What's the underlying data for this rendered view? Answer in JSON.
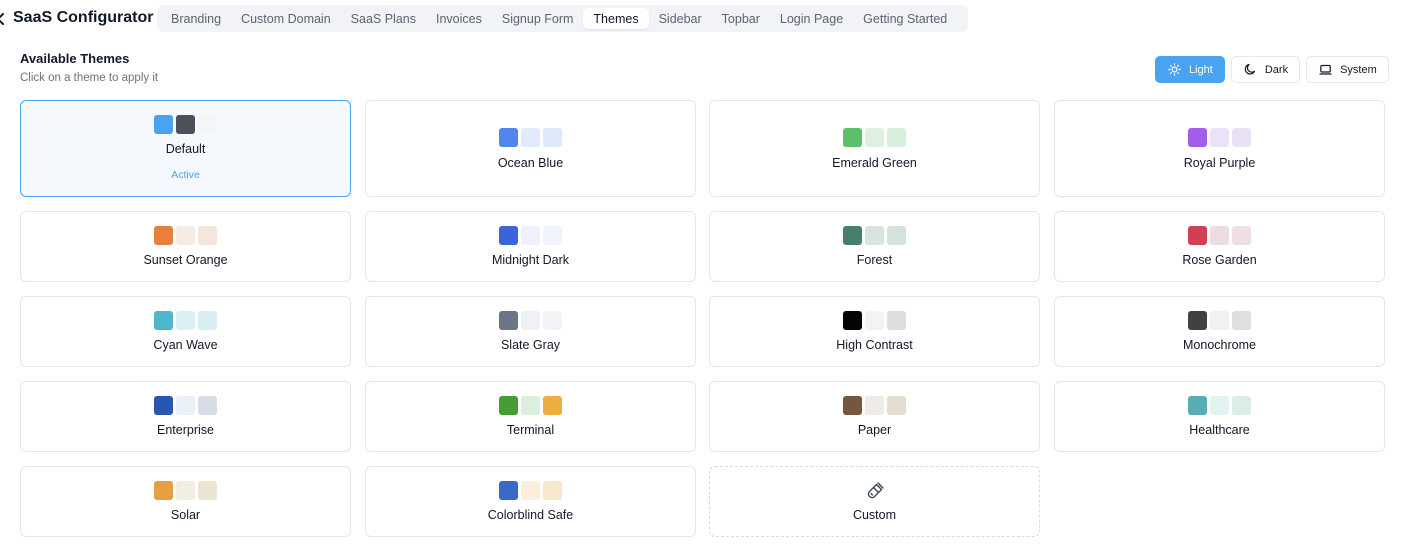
{
  "app": {
    "title": "SaaS Configurator"
  },
  "tabs": [
    {
      "label": "Branding",
      "active": false
    },
    {
      "label": "Custom Domain",
      "active": false
    },
    {
      "label": "SaaS Plans",
      "active": false
    },
    {
      "label": "Invoices",
      "active": false
    },
    {
      "label": "Signup Form",
      "active": false
    },
    {
      "label": "Themes",
      "active": true
    },
    {
      "label": "Sidebar",
      "active": false
    },
    {
      "label": "Topbar",
      "active": false
    },
    {
      "label": "Login Page",
      "active": false
    },
    {
      "label": "Getting Started",
      "active": false
    }
  ],
  "section": {
    "title": "Available Themes",
    "subtitle": "Click on a theme to apply it"
  },
  "mode": {
    "selected": "Light",
    "options": [
      {
        "label": "Light",
        "icon": "sun-icon"
      },
      {
        "label": "Dark",
        "icon": "moon-icon"
      },
      {
        "label": "System",
        "icon": "monitor-icon"
      }
    ]
  },
  "accent_color": "#4aa3f0",
  "themes": [
    {
      "name": "Default",
      "status": "Active",
      "colors": [
        "#4aa3f0",
        "#4b505a",
        "#f3f5f7"
      ]
    },
    {
      "name": "Ocean Blue",
      "colors": [
        "#4e86ea",
        "#e2ebfb",
        "#dde8fb"
      ]
    },
    {
      "name": "Emerald Green",
      "colors": [
        "#5cbf6c",
        "#ddf0e1",
        "#d9efdd"
      ]
    },
    {
      "name": "Royal Purple",
      "colors": [
        "#a25ee8",
        "#ebe2f7",
        "#e9e2f6"
      ]
    },
    {
      "name": "Sunset Orange",
      "colors": [
        "#e8803c",
        "#f5ebe3",
        "#f4e6dc"
      ]
    },
    {
      "name": "Midnight Dark",
      "colors": [
        "#3a63dc",
        "#eef2fb",
        "#f1f4fb"
      ]
    },
    {
      "name": "Forest",
      "colors": [
        "#46806a",
        "#d8e5de",
        "#d4e3da"
      ]
    },
    {
      "name": "Rose Garden",
      "colors": [
        "#d13f52",
        "#eddde0",
        "#efdfe3"
      ]
    },
    {
      "name": "Cyan Wave",
      "colors": [
        "#4fb6cc",
        "#dcf0f4",
        "#d8eef3"
      ]
    },
    {
      "name": "Slate Gray",
      "colors": [
        "#6b7585",
        "#eef1f6",
        "#f2f3f6"
      ]
    },
    {
      "name": "High Contrast",
      "colors": [
        "#050505",
        "#f3f3f3",
        "#dedede"
      ]
    },
    {
      "name": "Monochrome",
      "colors": [
        "#414141",
        "#f1f1f1",
        "#dfdfdf"
      ]
    },
    {
      "name": "Enterprise",
      "colors": [
        "#2a55b0",
        "#eaf0f7",
        "#d7dde7"
      ]
    },
    {
      "name": "Terminal",
      "colors": [
        "#449d35",
        "#dcefdc",
        "#efad3d"
      ]
    },
    {
      "name": "Paper",
      "colors": [
        "#76563d",
        "#efebe6",
        "#e3dccf"
      ]
    },
    {
      "name": "Healthcare",
      "colors": [
        "#58acb8",
        "#e2f3f2",
        "#d9eee9"
      ]
    },
    {
      "name": "Solar",
      "colors": [
        "#e5a043",
        "#f3eee2",
        "#ebe4d2"
      ]
    },
    {
      "name": "Colorblind Safe",
      "colors": [
        "#3a6ac8",
        "#fbefdc",
        "#f7e7cc"
      ]
    },
    {
      "name": "Custom",
      "custom": true,
      "icon": "paintbrush-icon"
    }
  ]
}
